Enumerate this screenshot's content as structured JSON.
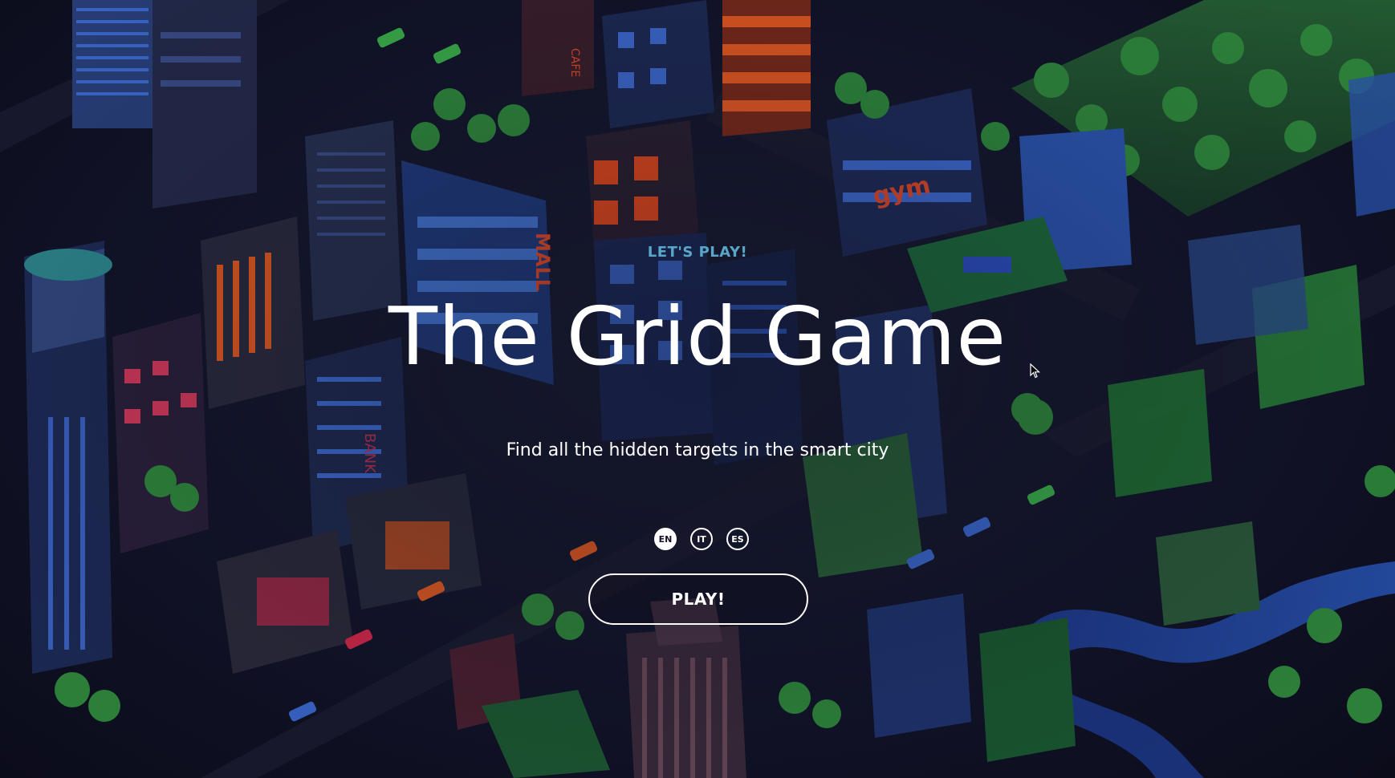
{
  "hero": {
    "eyebrow": "LET'S PLAY!",
    "title": "The Grid Game",
    "subtitle": "Find all the hidden targets in the smart city",
    "play_label": "PLAY!"
  },
  "languages": [
    {
      "label": "EN",
      "active": true
    },
    {
      "label": "IT",
      "active": false
    },
    {
      "label": "ES",
      "active": false
    }
  ],
  "background": {
    "signs": {
      "mall": "MALL",
      "gym": "gym",
      "bank": "BANK",
      "cafe": "CAFE"
    }
  },
  "colors": {
    "eyebrow": "#5aa6c9",
    "text": "#ffffff",
    "background": "#12142a"
  }
}
